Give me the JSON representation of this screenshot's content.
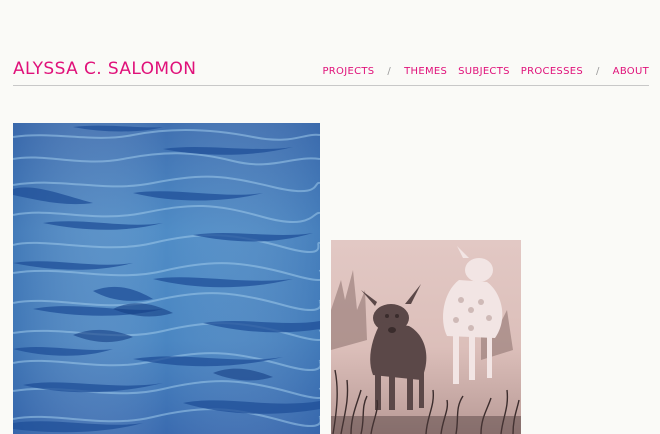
{
  "header": {
    "site_title": "ALYSSA C. SALOMON"
  },
  "nav": {
    "projects": "PROJECTS",
    "separator": "/",
    "themes": "THEMES",
    "subjects": "SUBJECTS",
    "processes": "PROCESSES",
    "about": "ABOUT"
  },
  "colors": {
    "accent": "#e0117a",
    "background": "#fafaf7",
    "rule": "#c8c8c8"
  },
  "gallery": {
    "images": [
      {
        "subject": "water-waves-photo"
      },
      {
        "subject": "two-deer-photo"
      }
    ]
  }
}
